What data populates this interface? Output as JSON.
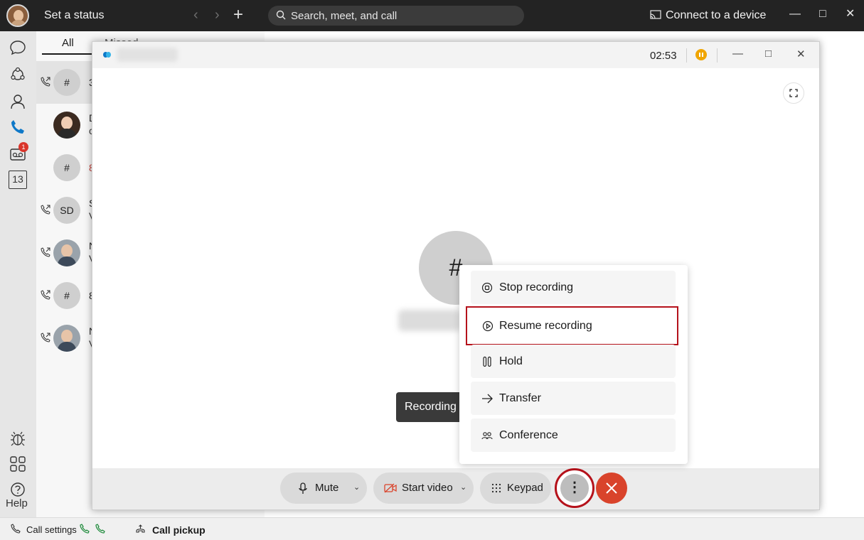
{
  "titlebar": {
    "status": "Set a status",
    "search_placeholder": "Search, meet, and call",
    "connect": "Connect to a device"
  },
  "rail": {
    "help": "Help",
    "voicemail_badge": "1",
    "calendar_day": "13"
  },
  "call_list": {
    "tabs": {
      "all": "All",
      "missed": "Missed"
    },
    "rows": [
      {
        "avatar": "#",
        "line1": "3",
        "line2": ""
      },
      {
        "avatar": "",
        "line1": "D",
        "line2": "c"
      },
      {
        "avatar": "#",
        "line1": "8",
        "line2": ""
      },
      {
        "avatar": "SD",
        "line1": "S",
        "line2": "V"
      },
      {
        "avatar": "",
        "line1": "N",
        "line2": "V"
      },
      {
        "avatar": "#",
        "line1": "8",
        "line2": ""
      },
      {
        "avatar": "",
        "line1": "N",
        "line2": "V"
      }
    ]
  },
  "bottombar": {
    "call_settings": "Call settings",
    "call_pickup": "Call pickup"
  },
  "call_window": {
    "timer": "02:53",
    "avatar_symbol": "#",
    "recording_tooltip": "Recording",
    "controls": {
      "mute": "Mute",
      "start_video": "Start video",
      "keypad": "Keypad",
      "more": "⋮"
    },
    "menu": [
      {
        "icon": "stop-circle-icon",
        "label": "Stop recording"
      },
      {
        "icon": "play-circle-icon",
        "label": "Resume recording"
      },
      {
        "icon": "hold-icon",
        "label": "Hold"
      },
      {
        "icon": "arrow-right-icon",
        "label": "Transfer"
      },
      {
        "icon": "people-icon",
        "label": "Conference"
      }
    ]
  },
  "colors": {
    "highlight_border": "#b5121b",
    "end_call": "#d9432b",
    "recording_indicator": "#f0a500",
    "call_icon_active": "#0e78c8"
  }
}
